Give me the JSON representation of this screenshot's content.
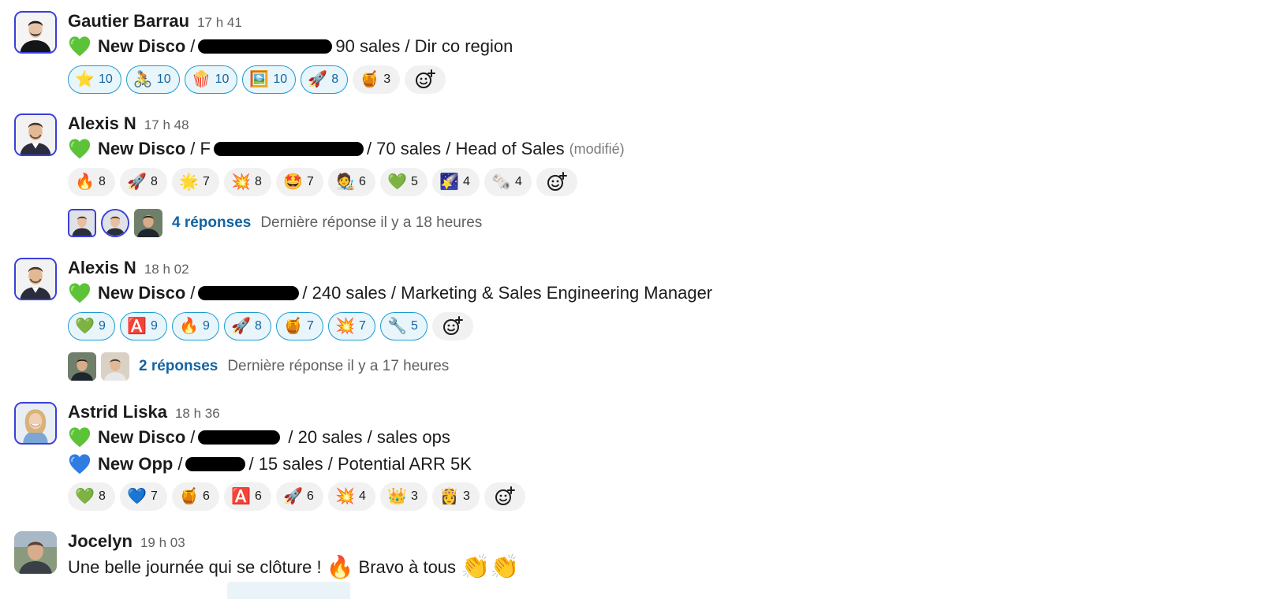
{
  "messages": [
    {
      "author": "Gautier Barrau",
      "time": "17 h 41",
      "lines": [
        {
          "heart": "green",
          "lead": "New Disco",
          "sep": "/",
          "rest": "90 sales / Dir co region"
        }
      ],
      "reactions": [
        {
          "emoji": "⭐",
          "count": "10",
          "mine": true
        },
        {
          "emoji": "🚴",
          "count": "10",
          "mine": true
        },
        {
          "emoji": "🍿",
          "count": "10",
          "mine": true
        },
        {
          "emoji": "🖼️",
          "count": "10",
          "mine": true
        },
        {
          "emoji": "🚀",
          "count": "8",
          "mine": true
        },
        {
          "emoji": "🍯",
          "count": "3",
          "mine": false
        }
      ]
    },
    {
      "author": "Alexis N",
      "time": "17 h 48",
      "lines": [
        {
          "heart": "green",
          "lead": "New Disco",
          "sep": "/ F",
          "rest": "/ 70 sales / Head of Sales",
          "edited": "(modifié)"
        }
      ],
      "reactions": [
        {
          "emoji": "🔥",
          "count": "8",
          "mine": false
        },
        {
          "emoji": "🚀",
          "count": "8",
          "mine": false
        },
        {
          "emoji": "🌟",
          "count": "7",
          "mine": false
        },
        {
          "emoji": "💥",
          "count": "8",
          "mine": false
        },
        {
          "emoji": "🤩",
          "count": "7",
          "mine": false
        },
        {
          "emoji": "🧑‍🎨",
          "count": "6",
          "mine": false
        },
        {
          "emoji": "💚",
          "count": "5",
          "mine": false
        },
        {
          "emoji": "🌠",
          "count": "4",
          "mine": false
        },
        {
          "emoji": "🗞️",
          "count": "4",
          "mine": false
        }
      ],
      "thread": {
        "replies": "4 réponses",
        "last": "Dernière réponse il y a 18 heures"
      }
    },
    {
      "author": "Alexis N",
      "time": "18 h 02",
      "lines": [
        {
          "heart": "green",
          "lead": "New Disco",
          "sep": "/",
          "rest": "/ 240 sales / Marketing & Sales Engineering Manager"
        }
      ],
      "reactions": [
        {
          "emoji": "💚",
          "count": "9",
          "mine": true
        },
        {
          "emoji": "🅰️",
          "count": "9",
          "mine": true
        },
        {
          "emoji": "🔥",
          "count": "9",
          "mine": true
        },
        {
          "emoji": "🚀",
          "count": "8",
          "mine": true
        },
        {
          "emoji": "🍯",
          "count": "7",
          "mine": true
        },
        {
          "emoji": "💥",
          "count": "7",
          "mine": true
        },
        {
          "emoji": "🔧",
          "count": "5",
          "mine": true
        }
      ],
      "thread": {
        "replies": "2 réponses",
        "last": "Dernière réponse il y a 17 heures"
      }
    },
    {
      "author": "Astrid Liska",
      "time": "18 h 36",
      "lines": [
        {
          "heart": "green",
          "lead": "New Disco",
          "sep": "/",
          "rest": "/ 20 sales  / sales ops"
        },
        {
          "heart": "blue",
          "lead": "New Opp",
          "sep": "/",
          "rest": "/ 15 sales / Potential ARR 5K"
        }
      ],
      "reactions": [
        {
          "emoji": "💚",
          "count": "8",
          "mine": false
        },
        {
          "emoji": "💙",
          "count": "7",
          "mine": false
        },
        {
          "emoji": "🍯",
          "count": "6",
          "mine": false
        },
        {
          "emoji": "🅰️",
          "count": "6",
          "mine": false
        },
        {
          "emoji": "🚀",
          "count": "6",
          "mine": false
        },
        {
          "emoji": "💥",
          "count": "4",
          "mine": false
        },
        {
          "emoji": "👑",
          "count": "3",
          "mine": false
        },
        {
          "emoji": "👸",
          "count": "3",
          "mine": false
        }
      ]
    },
    {
      "author": "Jocelyn",
      "time": "19 h 03",
      "text_before": "Une belle journée qui se clôture !",
      "fire": "🔥",
      "text_after": "Bravo à tous",
      "clap": "👏👏"
    }
  ],
  "colors": {
    "link": "#1264a3",
    "mine_border": "#1d9bd1",
    "mine_bg": "#e8f5fa",
    "pill_bg": "#f1f1f1",
    "avatar_ring": "#3a3fd8",
    "heart_green": "#5cc339",
    "heart_blue": "#2f7de1"
  },
  "icons": {
    "add_reaction": "smiley-plus-icon",
    "heart": "heart-icon"
  }
}
